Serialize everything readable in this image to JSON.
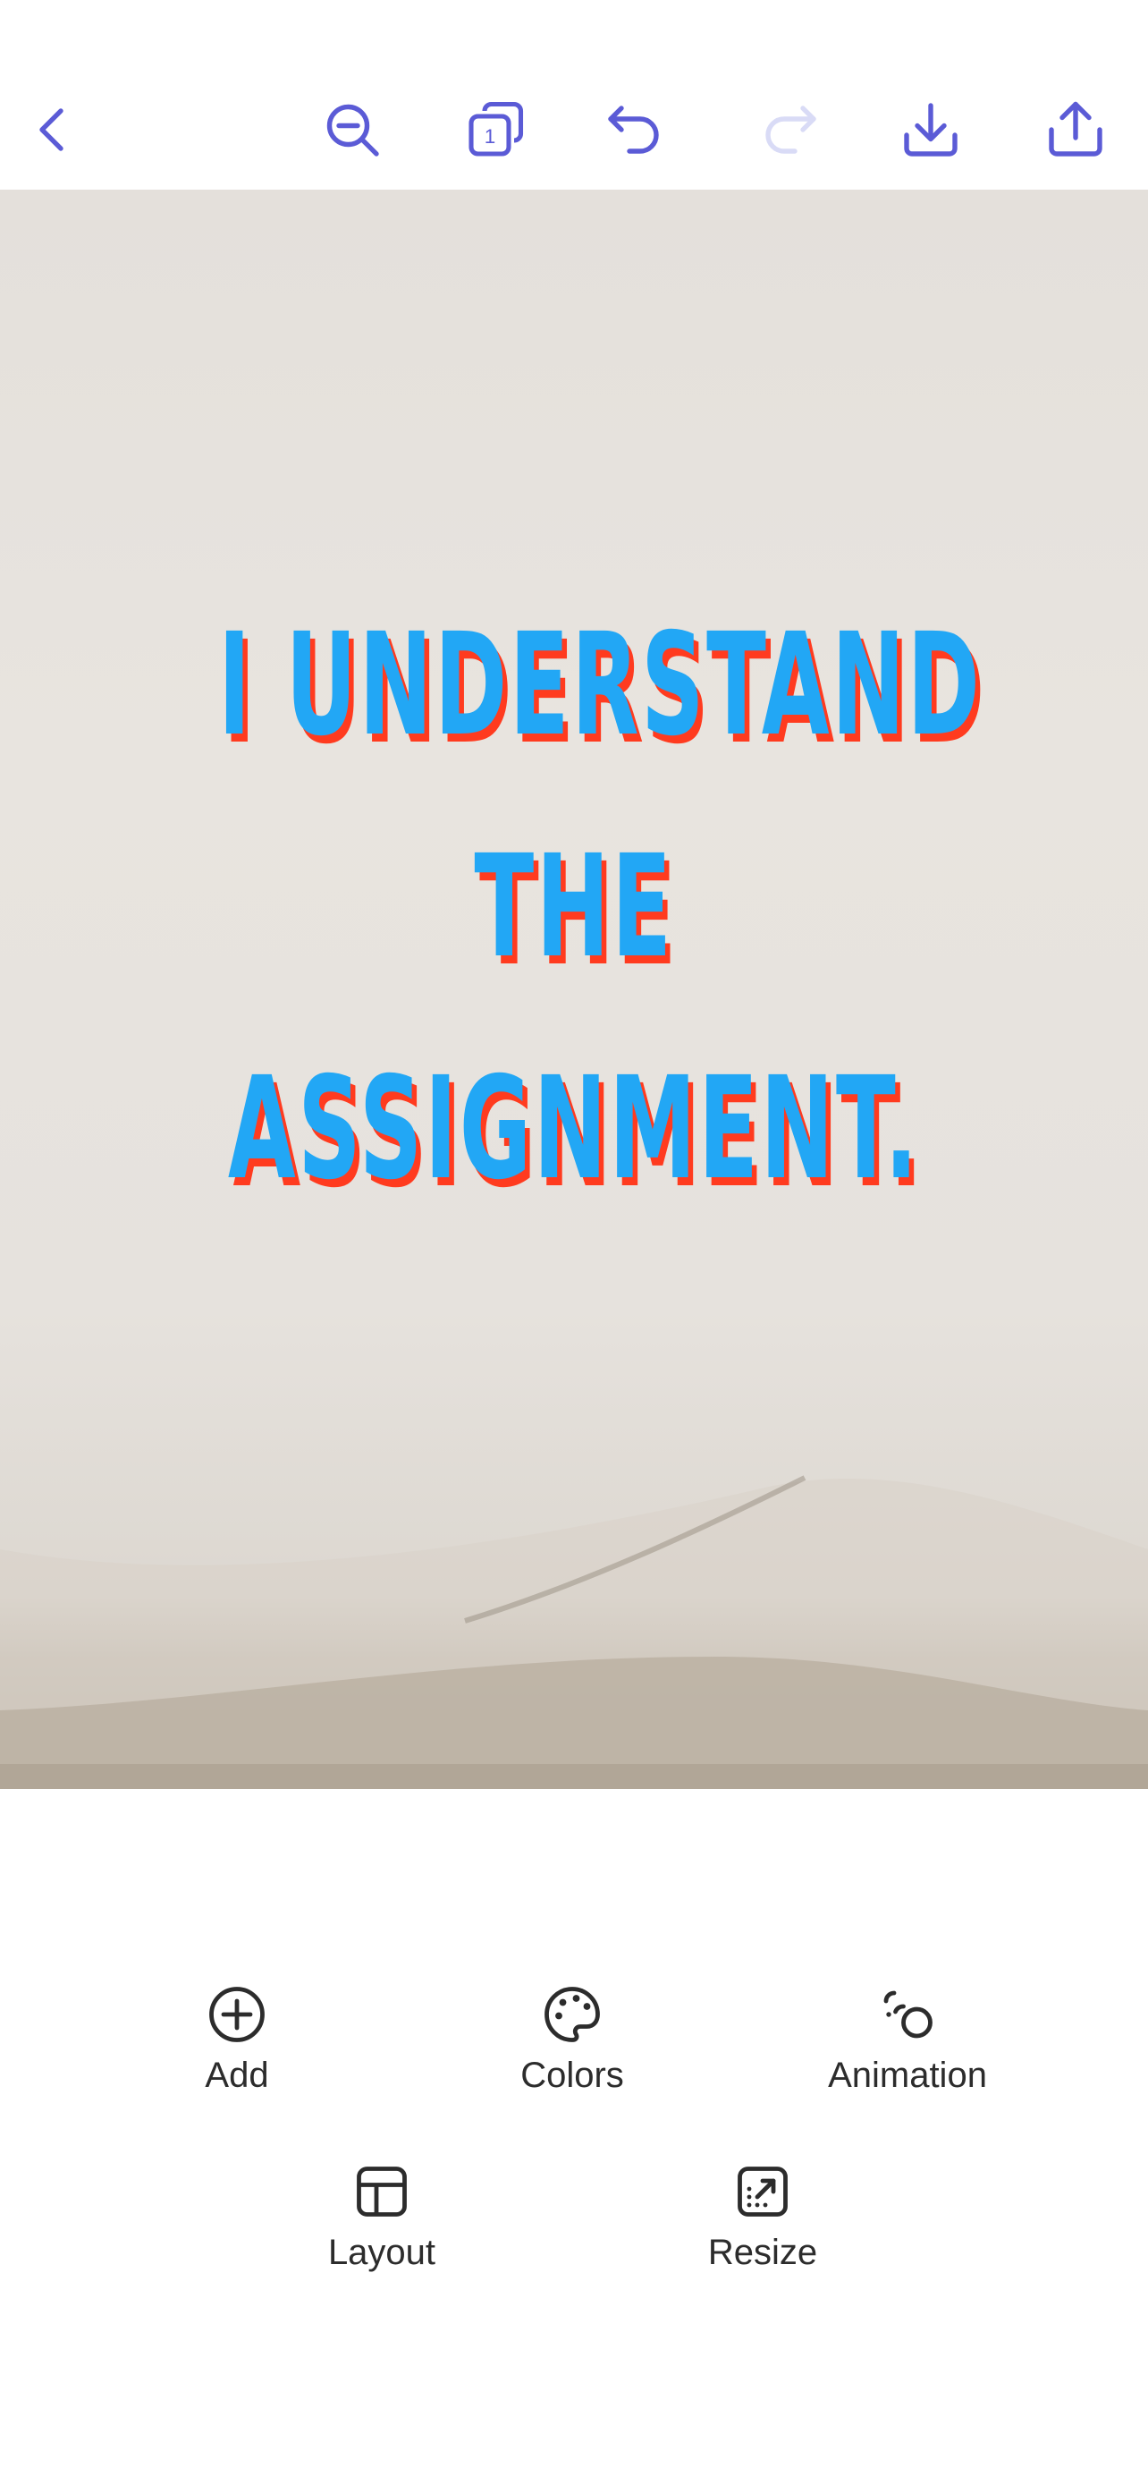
{
  "toolbar": {
    "icons": [
      "chevron-left-icon",
      "zoom-out-icon",
      "pages-icon",
      "undo-icon",
      "redo-icon",
      "download-icon",
      "share-icon"
    ],
    "page_count": "1",
    "accent_color": "#5b5bd6",
    "disabled_color": "#d9dbf6"
  },
  "canvas": {
    "design_lines": [
      "I UNDERSTAND",
      "THE",
      "ASSIGNMENT."
    ],
    "text_color": "#22a7f5",
    "shadow_color": "#ff3b1f"
  },
  "tools": {
    "add": {
      "label": "Add",
      "icon": "plus-circle-icon"
    },
    "colors": {
      "label": "Colors",
      "icon": "palette-icon"
    },
    "animation": {
      "label": "Animation",
      "icon": "animation-icon"
    },
    "layout": {
      "label": "Layout",
      "icon": "layout-icon"
    },
    "resize": {
      "label": "Resize",
      "icon": "resize-icon"
    }
  }
}
